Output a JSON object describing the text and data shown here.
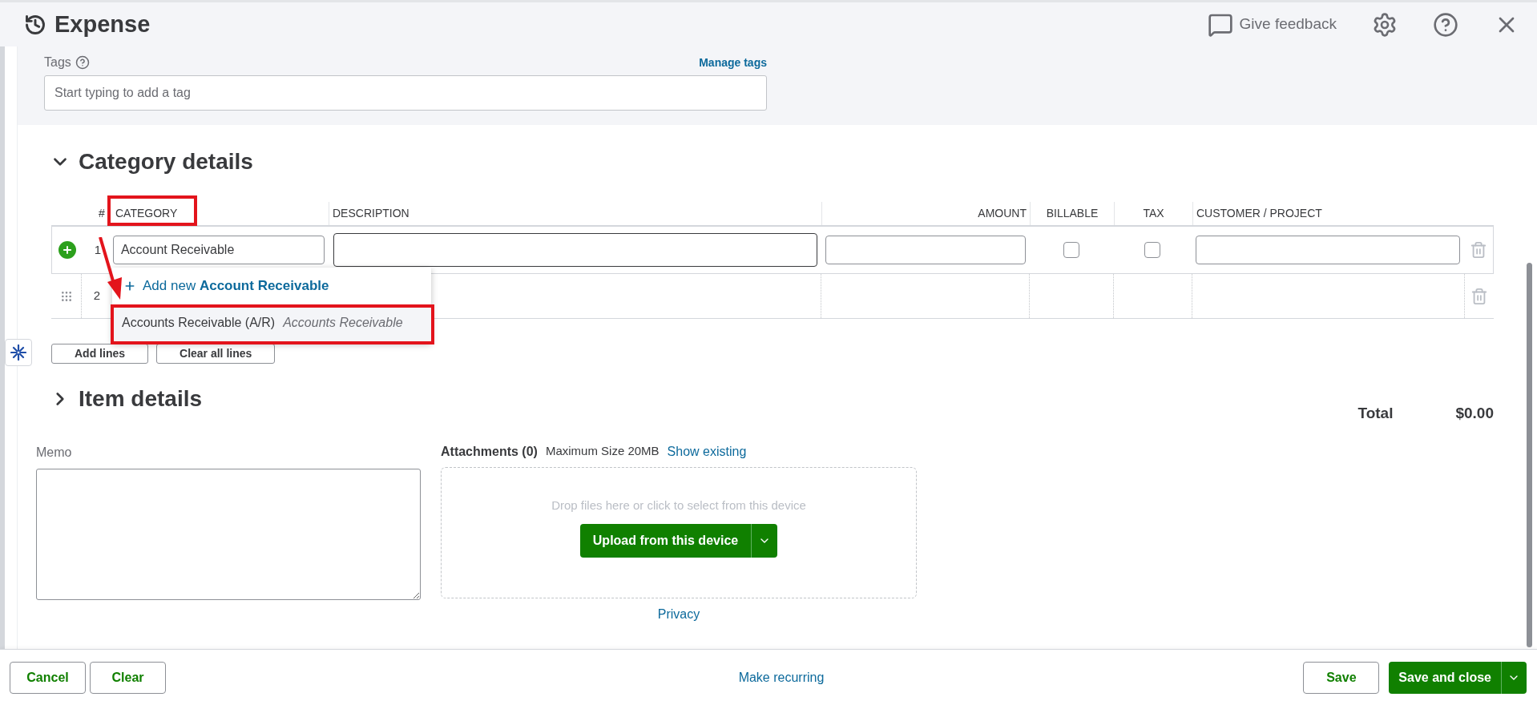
{
  "header": {
    "title": "Expense",
    "feedback": "Give feedback"
  },
  "tags": {
    "label": "Tags",
    "link": "Manage tags",
    "placeholder": "Start typing to add a tag"
  },
  "category_section": {
    "title": "Category details",
    "expanded": true
  },
  "table": {
    "columns": [
      "#",
      "CATEGORY",
      "DESCRIPTION",
      "AMOUNT",
      "BILLABLE",
      "TAX",
      "CUSTOMER / PROJECT"
    ],
    "rows": [
      {
        "number": "1",
        "editing": true,
        "category": "Account Receivable",
        "billable": false,
        "tax": false
      },
      {
        "number": "2",
        "editing": false
      }
    ]
  },
  "dropdown": {
    "add_prefix": "Add new",
    "add_name": "Account Receivable",
    "options": [
      {
        "name": "Accounts Receivable (A/R)",
        "type": "Accounts Receivable"
      }
    ]
  },
  "table_buttons": [
    "Add lines",
    "Clear all lines"
  ],
  "item_section": {
    "title": "Item details",
    "expanded": false
  },
  "total": {
    "label": "Total",
    "value": "$0.00"
  },
  "memo": {
    "label": "Memo"
  },
  "attachments": {
    "title": "Attachments (0)",
    "max_size": "Maximum Size 20MB",
    "link": "Show existing",
    "drop_text": "Drop files here or click to select from this device",
    "upload": "Upload from this device",
    "privacy": "Privacy"
  },
  "footer": {
    "left": [
      "Cancel",
      "Clear"
    ],
    "center": "Make recurring",
    "save": "Save",
    "save_close": "Save and close"
  }
}
